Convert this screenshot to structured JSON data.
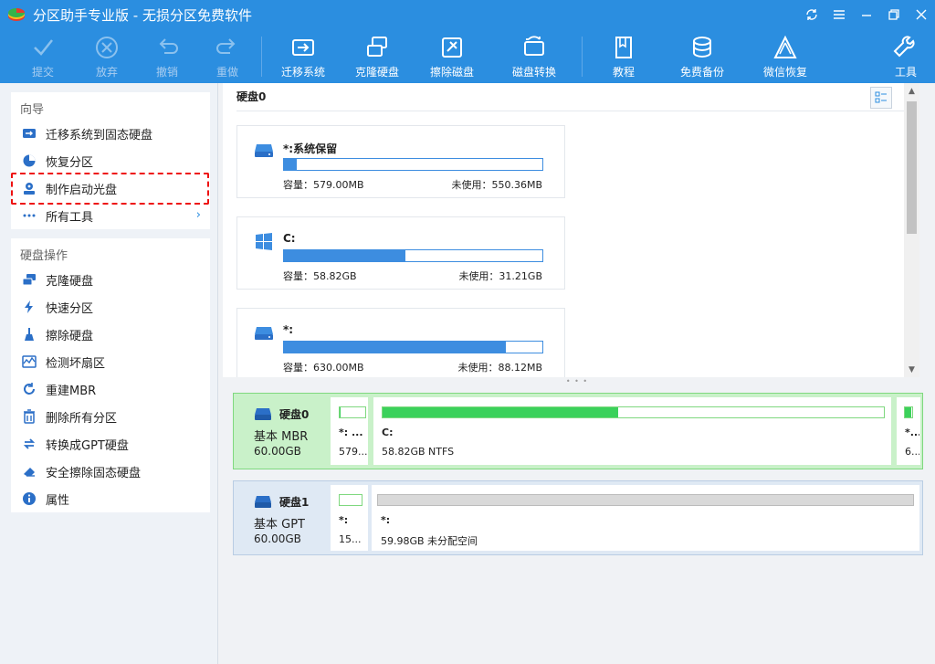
{
  "window": {
    "title": "分区助手专业版 - 无损分区免费软件",
    "controls": [
      "refresh-icon",
      "menu-icon",
      "minimize-icon",
      "restore-icon",
      "close-icon"
    ]
  },
  "toolbar": {
    "submit": "提交",
    "discard": "放弃",
    "undo": "撤销",
    "redo": "重做",
    "migrate_os": "迁移系统",
    "clone_disk": "克隆硬盘",
    "wipe_disk": "擦除磁盘",
    "disk_convert": "磁盘转换",
    "tutorial": "教程",
    "free_backup": "免费备份",
    "wechat_recovery": "微信恢复",
    "tools": "工具"
  },
  "sidebar": {
    "wizard_title": "向导",
    "wizard_items": [
      {
        "label": "迁移系统到固态硬盘",
        "icon": "migrate-icon"
      },
      {
        "label": "恢复分区",
        "icon": "restore-partition-icon"
      },
      {
        "label": "制作启动光盘",
        "icon": "bootable-disc-icon"
      },
      {
        "label": "所有工具",
        "icon": "more-icon"
      }
    ],
    "disk_ops_title": "硬盘操作",
    "disk_ops": [
      {
        "label": "克隆硬盘",
        "icon": "clone-icon"
      },
      {
        "label": "快速分区",
        "icon": "lightning-icon"
      },
      {
        "label": "擦除硬盘",
        "icon": "broom-icon"
      },
      {
        "label": "检测坏扇区",
        "icon": "scan-icon"
      },
      {
        "label": "重建MBR",
        "icon": "rebuild-icon"
      },
      {
        "label": "删除所有分区",
        "icon": "delete-icon"
      },
      {
        "label": "转换成GPT硬盘",
        "icon": "convert-icon"
      },
      {
        "label": "安全擦除固态硬盘",
        "icon": "eraser-icon"
      },
      {
        "label": "属性",
        "icon": "info-icon"
      }
    ],
    "highlight_color": "#e11111"
  },
  "disk_view": {
    "heading": "硬盘0",
    "partitions": [
      {
        "name": "*:系统保留",
        "capacity": "容量：579.00MB",
        "free": "未使用：550.36MB",
        "used_fraction": 0.05,
        "icon": "drive-icon"
      },
      {
        "name": "C:",
        "capacity": "容量：58.82GB",
        "free": "未使用：31.21GB",
        "used_fraction": 0.47,
        "icon": "windows-icon"
      },
      {
        "name": "*:",
        "capacity": "容量：630.00MB",
        "free": "未使用：88.12MB",
        "used_fraction": 0.86,
        "icon": "drive-icon"
      }
    ]
  },
  "disks": [
    {
      "name": "硬盘0",
      "type": "基本 MBR",
      "size": "60.00GB",
      "color": "#c9f1c9",
      "partitions": [
        {
          "label": "*: ...",
          "info": "579...",
          "used_fraction": 0.05
        },
        {
          "label": "C:",
          "info": "58.82GB NTFS",
          "used_fraction": 0.47
        },
        {
          "label": "*...",
          "info": "6...",
          "used_fraction": 0.86
        }
      ]
    },
    {
      "name": "硬盘1",
      "type": "基本 GPT",
      "size": "60.00GB",
      "color": "#dfe9f4",
      "partitions": [
        {
          "label": "*:",
          "info": "15...",
          "used_fraction": 0.0
        },
        {
          "label": "*:",
          "info": "59.98GB 未分配空间",
          "used_fraction": 0.0
        }
      ]
    }
  ],
  "colors": {
    "accent": "#2b8ee0",
    "bar_fill": "#3d8de0",
    "disk_green": "#3bd15b"
  }
}
